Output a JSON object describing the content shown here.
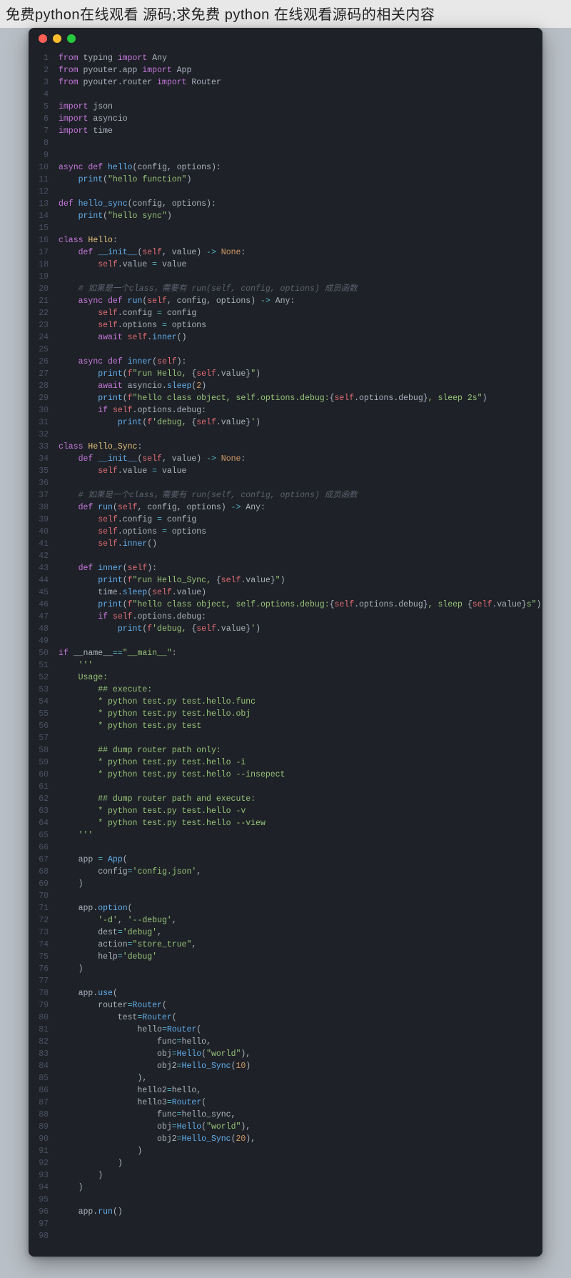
{
  "header": "免费python在线观看 源码;求免费 python 在线观看源码的相关内容",
  "code": [
    [
      [
        "kw",
        "from"
      ],
      [
        "pln",
        " typing "
      ],
      [
        "kw",
        "import"
      ],
      [
        "pln",
        " Any"
      ]
    ],
    [
      [
        "kw",
        "from"
      ],
      [
        "pln",
        " pyouter.app "
      ],
      [
        "kw",
        "import"
      ],
      [
        "pln",
        " App"
      ]
    ],
    [
      [
        "kw",
        "from"
      ],
      [
        "pln",
        " pyouter.router "
      ],
      [
        "kw",
        "import"
      ],
      [
        "pln",
        " Router"
      ]
    ],
    [],
    [
      [
        "kw",
        "import"
      ],
      [
        "pln",
        " json"
      ]
    ],
    [
      [
        "kw",
        "import"
      ],
      [
        "pln",
        " asyncio"
      ]
    ],
    [
      [
        "kw",
        "import"
      ],
      [
        "pln",
        " time"
      ]
    ],
    [],
    [],
    [
      [
        "kw",
        "async def "
      ],
      [
        "fn",
        "hello"
      ],
      [
        "pln",
        "(config, options):"
      ]
    ],
    [
      [
        "pln",
        "    "
      ],
      [
        "fn",
        "print"
      ],
      [
        "pln",
        "("
      ],
      [
        "str",
        "\"hello function\""
      ],
      [
        "pln",
        ")"
      ]
    ],
    [],
    [
      [
        "kw",
        "def "
      ],
      [
        "fn",
        "hello_sync"
      ],
      [
        "pln",
        "(config, options):"
      ]
    ],
    [
      [
        "pln",
        "    "
      ],
      [
        "fn",
        "print"
      ],
      [
        "pln",
        "("
      ],
      [
        "str",
        "\"hello sync\""
      ],
      [
        "pln",
        ")"
      ]
    ],
    [],
    [
      [
        "kw",
        "class "
      ],
      [
        "cls",
        "Hello"
      ],
      [
        "pln",
        ":"
      ]
    ],
    [
      [
        "pln",
        "    "
      ],
      [
        "kw",
        "def "
      ],
      [
        "fn",
        "__init__"
      ],
      [
        "pln",
        "("
      ],
      [
        "slf",
        "self"
      ],
      [
        "pln",
        ", value) "
      ],
      [
        "op",
        "->"
      ],
      [
        "pln",
        " "
      ],
      [
        "num",
        "None"
      ],
      [
        "pln",
        ":"
      ]
    ],
    [
      [
        "pln",
        "        "
      ],
      [
        "slf",
        "self"
      ],
      [
        "pln",
        ".value "
      ],
      [
        "op",
        "="
      ],
      [
        "pln",
        " value"
      ]
    ],
    [],
    [
      [
        "pln",
        "    "
      ],
      [
        "cmt",
        "# 如果是一个class，需要有 run(self, config, options) 成员函数"
      ]
    ],
    [
      [
        "pln",
        "    "
      ],
      [
        "kw",
        "async def "
      ],
      [
        "fn",
        "run"
      ],
      [
        "pln",
        "("
      ],
      [
        "slf",
        "self"
      ],
      [
        "pln",
        ", config, options) "
      ],
      [
        "op",
        "->"
      ],
      [
        "pln",
        " Any:"
      ]
    ],
    [
      [
        "pln",
        "        "
      ],
      [
        "slf",
        "self"
      ],
      [
        "pln",
        ".config "
      ],
      [
        "op",
        "="
      ],
      [
        "pln",
        " config"
      ]
    ],
    [
      [
        "pln",
        "        "
      ],
      [
        "slf",
        "self"
      ],
      [
        "pln",
        ".options "
      ],
      [
        "op",
        "="
      ],
      [
        "pln",
        " options"
      ]
    ],
    [
      [
        "pln",
        "        "
      ],
      [
        "kw",
        "await "
      ],
      [
        "slf",
        "self"
      ],
      [
        "pln",
        "."
      ],
      [
        "fn",
        "inner"
      ],
      [
        "pln",
        "()"
      ]
    ],
    [],
    [
      [
        "pln",
        "    "
      ],
      [
        "kw",
        "async def "
      ],
      [
        "fn",
        "inner"
      ],
      [
        "pln",
        "("
      ],
      [
        "slf",
        "self"
      ],
      [
        "pln",
        "):"
      ]
    ],
    [
      [
        "pln",
        "        "
      ],
      [
        "fn",
        "print"
      ],
      [
        "pln",
        "("
      ],
      [
        "red2",
        "f"
      ],
      [
        "str",
        "\"run Hello, "
      ],
      [
        "pln",
        "{"
      ],
      [
        "slf",
        "self"
      ],
      [
        "pln",
        ".value}"
      ],
      [
        "str",
        "\""
      ],
      [
        "pln",
        ")"
      ]
    ],
    [
      [
        "pln",
        "        "
      ],
      [
        "kw",
        "await"
      ],
      [
        "pln",
        " asyncio."
      ],
      [
        "fn",
        "sleep"
      ],
      [
        "pln",
        "("
      ],
      [
        "num",
        "2"
      ],
      [
        "pln",
        ")"
      ]
    ],
    [
      [
        "pln",
        "        "
      ],
      [
        "fn",
        "print"
      ],
      [
        "pln",
        "("
      ],
      [
        "red2",
        "f"
      ],
      [
        "str",
        "\"hello class object, self.options.debug:"
      ],
      [
        "pln",
        "{"
      ],
      [
        "slf",
        "self"
      ],
      [
        "pln",
        ".options.debug}"
      ],
      [
        "str",
        ", sleep 2s\""
      ],
      [
        "pln",
        ")"
      ]
    ],
    [
      [
        "pln",
        "        "
      ],
      [
        "kw",
        "if "
      ],
      [
        "slf",
        "self"
      ],
      [
        "pln",
        ".options.debug:"
      ]
    ],
    [
      [
        "pln",
        "            "
      ],
      [
        "fn",
        "print"
      ],
      [
        "pln",
        "("
      ],
      [
        "red2",
        "f"
      ],
      [
        "str",
        "'debug, "
      ],
      [
        "pln",
        "{"
      ],
      [
        "slf",
        "self"
      ],
      [
        "pln",
        ".value}"
      ],
      [
        "str",
        "'"
      ],
      [
        "pln",
        ")"
      ]
    ],
    [],
    [
      [
        "kw",
        "class "
      ],
      [
        "cls",
        "Hello_Sync"
      ],
      [
        "pln",
        ":"
      ]
    ],
    [
      [
        "pln",
        "    "
      ],
      [
        "kw",
        "def "
      ],
      [
        "fn",
        "__init__"
      ],
      [
        "pln",
        "("
      ],
      [
        "slf",
        "self"
      ],
      [
        "pln",
        ", value) "
      ],
      [
        "op",
        "->"
      ],
      [
        "pln",
        " "
      ],
      [
        "num",
        "None"
      ],
      [
        "pln",
        ":"
      ]
    ],
    [
      [
        "pln",
        "        "
      ],
      [
        "slf",
        "self"
      ],
      [
        "pln",
        ".value "
      ],
      [
        "op",
        "="
      ],
      [
        "pln",
        " value"
      ]
    ],
    [],
    [
      [
        "pln",
        "    "
      ],
      [
        "cmt",
        "# 如果是一个class，需要有 run(self, config, options) 成员函数"
      ]
    ],
    [
      [
        "pln",
        "    "
      ],
      [
        "kw",
        "def "
      ],
      [
        "fn",
        "run"
      ],
      [
        "pln",
        "("
      ],
      [
        "slf",
        "self"
      ],
      [
        "pln",
        ", config, options) "
      ],
      [
        "op",
        "->"
      ],
      [
        "pln",
        " Any:"
      ]
    ],
    [
      [
        "pln",
        "        "
      ],
      [
        "slf",
        "self"
      ],
      [
        "pln",
        ".config "
      ],
      [
        "op",
        "="
      ],
      [
        "pln",
        " config"
      ]
    ],
    [
      [
        "pln",
        "        "
      ],
      [
        "slf",
        "self"
      ],
      [
        "pln",
        ".options "
      ],
      [
        "op",
        "="
      ],
      [
        "pln",
        " options"
      ]
    ],
    [
      [
        "pln",
        "        "
      ],
      [
        "slf",
        "self"
      ],
      [
        "pln",
        "."
      ],
      [
        "fn",
        "inner"
      ],
      [
        "pln",
        "()"
      ]
    ],
    [],
    [
      [
        "pln",
        "    "
      ],
      [
        "kw",
        "def "
      ],
      [
        "fn",
        "inner"
      ],
      [
        "pln",
        "("
      ],
      [
        "slf",
        "self"
      ],
      [
        "pln",
        "):"
      ]
    ],
    [
      [
        "pln",
        "        "
      ],
      [
        "fn",
        "print"
      ],
      [
        "pln",
        "("
      ],
      [
        "red2",
        "f"
      ],
      [
        "str",
        "\"run Hello_Sync, "
      ],
      [
        "pln",
        "{"
      ],
      [
        "slf",
        "self"
      ],
      [
        "pln",
        ".value}"
      ],
      [
        "str",
        "\""
      ],
      [
        "pln",
        ")"
      ]
    ],
    [
      [
        "pln",
        "        time."
      ],
      [
        "fn",
        "sleep"
      ],
      [
        "pln",
        "("
      ],
      [
        "slf",
        "self"
      ],
      [
        "pln",
        ".value)"
      ]
    ],
    [
      [
        "pln",
        "        "
      ],
      [
        "fn",
        "print"
      ],
      [
        "pln",
        "("
      ],
      [
        "red2",
        "f"
      ],
      [
        "str",
        "\"hello class object, self.options.debug:"
      ],
      [
        "pln",
        "{"
      ],
      [
        "slf",
        "self"
      ],
      [
        "pln",
        ".options.debug}"
      ],
      [
        "str",
        ", sleep "
      ],
      [
        "pln",
        "{"
      ],
      [
        "slf",
        "self"
      ],
      [
        "pln",
        ".value}"
      ],
      [
        "str",
        "s\""
      ],
      [
        "pln",
        ")"
      ]
    ],
    [
      [
        "pln",
        "        "
      ],
      [
        "kw",
        "if "
      ],
      [
        "slf",
        "self"
      ],
      [
        "pln",
        ".options.debug:"
      ]
    ],
    [
      [
        "pln",
        "            "
      ],
      [
        "fn",
        "print"
      ],
      [
        "pln",
        "("
      ],
      [
        "red2",
        "f"
      ],
      [
        "str",
        "'debug, "
      ],
      [
        "pln",
        "{"
      ],
      [
        "slf",
        "self"
      ],
      [
        "pln",
        ".value}"
      ],
      [
        "str",
        "'"
      ],
      [
        "pln",
        ")"
      ]
    ],
    [],
    [
      [
        "kw",
        "if"
      ],
      [
        "pln",
        " __name__"
      ],
      [
        "op",
        "=="
      ],
      [
        "str",
        "\"__main__\""
      ],
      [
        "pln",
        ":"
      ]
    ],
    [
      [
        "pln",
        "    "
      ],
      [
        "str",
        "'''"
      ]
    ],
    [
      [
        "pln",
        "    "
      ],
      [
        "str",
        "Usage:"
      ]
    ],
    [
      [
        "pln",
        "        "
      ],
      [
        "str",
        "## execute:"
      ]
    ],
    [
      [
        "pln",
        "        "
      ],
      [
        "str",
        "* python test.py test.hello.func"
      ]
    ],
    [
      [
        "pln",
        "        "
      ],
      [
        "str",
        "* python test.py test.hello.obj"
      ]
    ],
    [
      [
        "pln",
        "        "
      ],
      [
        "str",
        "* python test.py test"
      ]
    ],
    [],
    [
      [
        "pln",
        "        "
      ],
      [
        "str",
        "## dump router path only:"
      ]
    ],
    [
      [
        "pln",
        "        "
      ],
      [
        "str",
        "* python test.py test.hello -i"
      ]
    ],
    [
      [
        "pln",
        "        "
      ],
      [
        "str",
        "* python test.py test.hello --insepect"
      ]
    ],
    [],
    [
      [
        "pln",
        "        "
      ],
      [
        "str",
        "## dump router path and execute:"
      ]
    ],
    [
      [
        "pln",
        "        "
      ],
      [
        "str",
        "* python test.py test.hello -v"
      ]
    ],
    [
      [
        "pln",
        "        "
      ],
      [
        "str",
        "* python test.py test.hello --view"
      ]
    ],
    [
      [
        "pln",
        "    "
      ],
      [
        "str",
        "'''"
      ]
    ],
    [],
    [
      [
        "pln",
        "    app "
      ],
      [
        "op",
        "="
      ],
      [
        "pln",
        " "
      ],
      [
        "fn",
        "App"
      ],
      [
        "pln",
        "("
      ]
    ],
    [
      [
        "pln",
        "        config"
      ],
      [
        "op",
        "="
      ],
      [
        "str",
        "'config.json'"
      ],
      [
        "pln",
        ","
      ]
    ],
    [
      [
        "pln",
        "    )"
      ]
    ],
    [],
    [
      [
        "pln",
        "    app."
      ],
      [
        "fn",
        "option"
      ],
      [
        "pln",
        "("
      ]
    ],
    [
      [
        "pln",
        "        "
      ],
      [
        "str",
        "'-d'"
      ],
      [
        "pln",
        ", "
      ],
      [
        "str",
        "'--debug'"
      ],
      [
        "pln",
        ","
      ]
    ],
    [
      [
        "pln",
        "        dest"
      ],
      [
        "op",
        "="
      ],
      [
        "str",
        "'debug'"
      ],
      [
        "pln",
        ","
      ]
    ],
    [
      [
        "pln",
        "        action"
      ],
      [
        "op",
        "="
      ],
      [
        "str",
        "\"store_true\""
      ],
      [
        "pln",
        ","
      ]
    ],
    [
      [
        "pln",
        "        help"
      ],
      [
        "op",
        "="
      ],
      [
        "str",
        "'debug'"
      ]
    ],
    [
      [
        "pln",
        "    )"
      ]
    ],
    [],
    [
      [
        "pln",
        "    app."
      ],
      [
        "fn",
        "use"
      ],
      [
        "pln",
        "("
      ]
    ],
    [
      [
        "pln",
        "        router"
      ],
      [
        "op",
        "="
      ],
      [
        "fn",
        "Router"
      ],
      [
        "pln",
        "("
      ]
    ],
    [
      [
        "pln",
        "            test"
      ],
      [
        "op",
        "="
      ],
      [
        "fn",
        "Router"
      ],
      [
        "pln",
        "("
      ]
    ],
    [
      [
        "pln",
        "                hello"
      ],
      [
        "op",
        "="
      ],
      [
        "fn",
        "Router"
      ],
      [
        "pln",
        "("
      ]
    ],
    [
      [
        "pln",
        "                    func"
      ],
      [
        "op",
        "="
      ],
      [
        "pln",
        "hello,"
      ]
    ],
    [
      [
        "pln",
        "                    obj"
      ],
      [
        "op",
        "="
      ],
      [
        "fn",
        "Hello"
      ],
      [
        "pln",
        "("
      ],
      [
        "str",
        "\"world\""
      ],
      [
        "pln",
        "),"
      ]
    ],
    [
      [
        "pln",
        "                    obj2"
      ],
      [
        "op",
        "="
      ],
      [
        "fn",
        "Hello_Sync"
      ],
      [
        "pln",
        "("
      ],
      [
        "num",
        "10"
      ],
      [
        "pln",
        ")"
      ]
    ],
    [
      [
        "pln",
        "                ),"
      ]
    ],
    [
      [
        "pln",
        "                hello2"
      ],
      [
        "op",
        "="
      ],
      [
        "pln",
        "hello,"
      ]
    ],
    [
      [
        "pln",
        "                hello3"
      ],
      [
        "op",
        "="
      ],
      [
        "fn",
        "Router"
      ],
      [
        "pln",
        "("
      ]
    ],
    [
      [
        "pln",
        "                    func"
      ],
      [
        "op",
        "="
      ],
      [
        "pln",
        "hello_sync,"
      ]
    ],
    [
      [
        "pln",
        "                    obj"
      ],
      [
        "op",
        "="
      ],
      [
        "fn",
        "Hello"
      ],
      [
        "pln",
        "("
      ],
      [
        "str",
        "\"world\""
      ],
      [
        "pln",
        "),"
      ]
    ],
    [
      [
        "pln",
        "                    obj2"
      ],
      [
        "op",
        "="
      ],
      [
        "fn",
        "Hello_Sync"
      ],
      [
        "pln",
        "("
      ],
      [
        "num",
        "20"
      ],
      [
        "pln",
        "),"
      ]
    ],
    [
      [
        "pln",
        "                )"
      ]
    ],
    [
      [
        "pln",
        "            )"
      ]
    ],
    [
      [
        "pln",
        "        )"
      ]
    ],
    [
      [
        "pln",
        "    )"
      ]
    ],
    [],
    [
      [
        "pln",
        "    app."
      ],
      [
        "fn",
        "run"
      ],
      [
        "pln",
        "()"
      ]
    ],
    [],
    []
  ]
}
